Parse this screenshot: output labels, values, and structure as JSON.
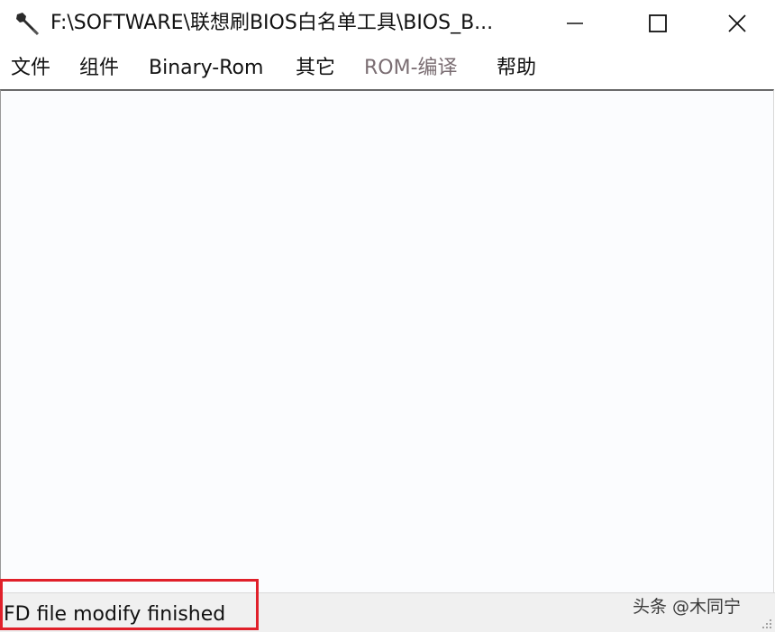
{
  "window": {
    "title": "F:\\SOFTWARE\\联想刷BIOS白名单工具\\BIOS_B...",
    "icon": "wrench-icon"
  },
  "titlebar_controls": {
    "minimize": "minimize-icon",
    "maximize": "maximize-icon",
    "close": "close-icon"
  },
  "menu": {
    "items": [
      {
        "label": "文件",
        "enabled": true
      },
      {
        "label": "组件",
        "enabled": true
      },
      {
        "label": "Binary-Rom",
        "enabled": true
      },
      {
        "label": "其它",
        "enabled": true
      },
      {
        "label": "ROM-编译",
        "enabled": false
      },
      {
        "label": "帮助",
        "enabled": true
      }
    ]
  },
  "status": {
    "text": "FD file modify finished",
    "highlight_color": "#e0202a"
  },
  "watermark": {
    "text": "头条 @木同宁"
  }
}
